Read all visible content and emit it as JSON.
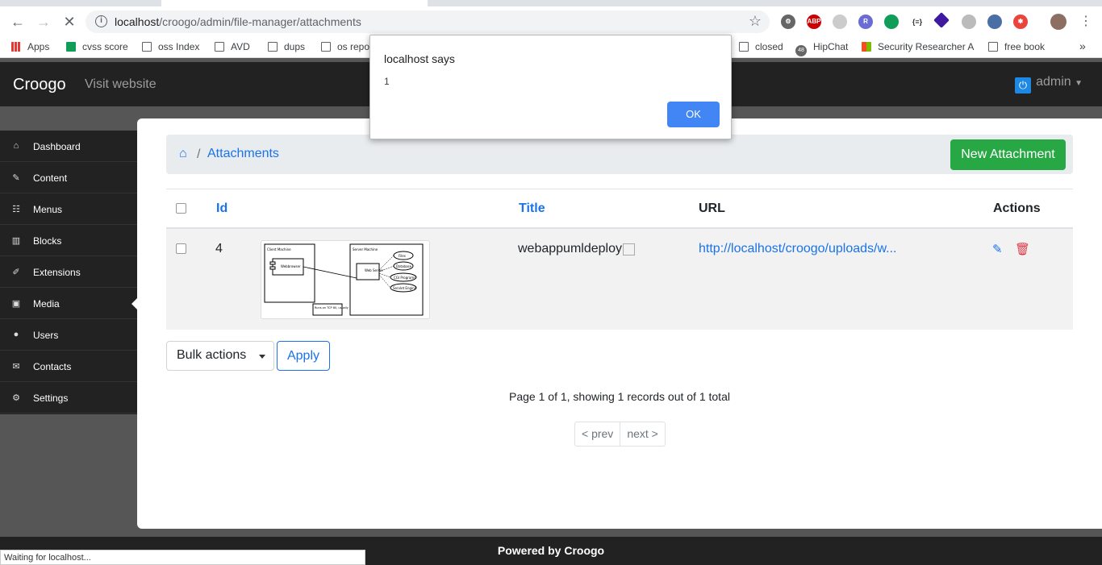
{
  "browser": {
    "url_host": "localhost",
    "url_path": "/croogo/admin/file-manager/attachments",
    "bookmarks": [
      "Apps",
      "cvss score",
      "oss Index",
      "AVD",
      "dups",
      "os repo",
      "closed",
      "HipChat",
      "Security Researcher A",
      "free book"
    ],
    "hipchat_badge": "48",
    "more_bookmarks": "»",
    "status_text": "Waiting for localhost..."
  },
  "header": {
    "brand": "Croogo",
    "visit_link": "Visit website",
    "user": "admin"
  },
  "sidebar": {
    "items": [
      {
        "label": "Dashboard",
        "icon": "home-icon"
      },
      {
        "label": "Content",
        "icon": "edit-icon"
      },
      {
        "label": "Menus",
        "icon": "sitemap-icon"
      },
      {
        "label": "Blocks",
        "icon": "columns-icon"
      },
      {
        "label": "Extensions",
        "icon": "magic-icon"
      },
      {
        "label": "Media",
        "icon": "picture-icon"
      },
      {
        "label": "Users",
        "icon": "user-icon"
      },
      {
        "label": "Contacts",
        "icon": "comments-icon"
      },
      {
        "label": "Settings",
        "icon": "cog-icon"
      }
    ],
    "active": "Media"
  },
  "breadcrumb": {
    "separator": "/",
    "current": "Attachments"
  },
  "actions": {
    "new_attachment": "New Attachment",
    "bulk_actions": "Bulk actions",
    "apply": "Apply"
  },
  "table": {
    "columns": {
      "id": "Id",
      "title": "Title",
      "url": "URL",
      "actions": "Actions"
    },
    "rows": [
      {
        "id": "4",
        "title": "webappumldeploy",
        "url": "http://localhost/croogo/uploads/w..."
      }
    ]
  },
  "thumbnail": {
    "client_title": "Client Machine",
    "client_box": "Webbrowser",
    "server_title": "Server Machine",
    "server_box": "Web Server",
    "nodes": [
      "Files",
      "Database",
      "CGI Programs",
      "Servlet Engine"
    ],
    "note": "Runs on TCP 80, usually"
  },
  "pagination": {
    "summary": "Page 1 of 1, showing 1 records out of 1 total",
    "prev": "< prev",
    "next": "next >"
  },
  "footer": {
    "text": "Powered by Croogo"
  },
  "dialog": {
    "title": "localhost says",
    "message": "1",
    "ok": "OK"
  }
}
